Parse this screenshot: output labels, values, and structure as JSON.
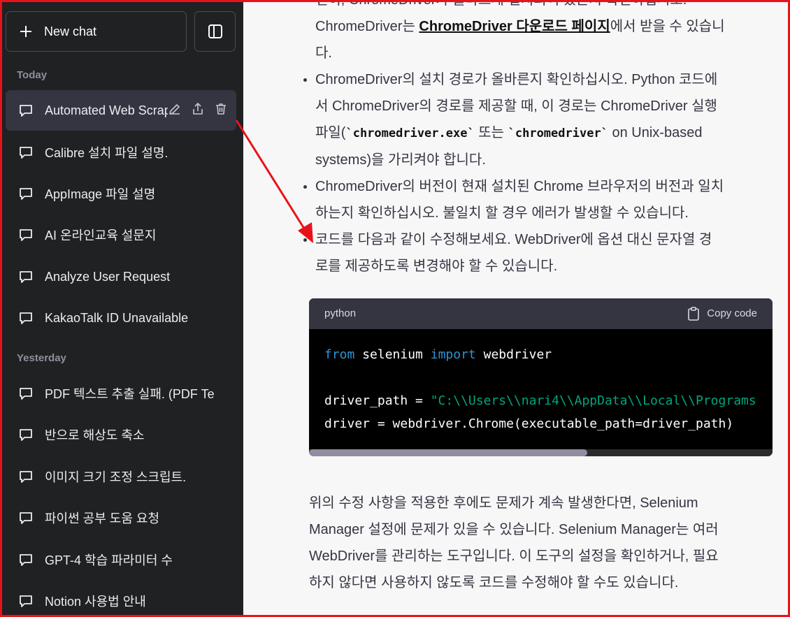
{
  "sidebar": {
    "new_chat_label": "New chat",
    "sections": [
      {
        "label": "Today"
      },
      {
        "label": "Yesterday"
      }
    ],
    "today_items": [
      "Automated Web Scraping",
      "Calibre 설치 파일 설명.",
      "AppImage 파일 설명",
      "AI 온라인교육 설문지",
      "Analyze User Request",
      "KakaoTalk ID Unavailable"
    ],
    "yesterday_items": [
      "PDF 텍스트 추출 실패. (PDF Te",
      "반으로 해상도 축소",
      "이미지 크기 조정 스크립트.",
      "파이썬 공부 도움 요청",
      "GPT-4 학습 파라미터 수",
      "Notion 사용법 안내"
    ],
    "icons": {
      "new_chat": "plus-icon",
      "toggle": "sidebar-toggle-icon",
      "chat": "chat-bubble-icon",
      "edit": "pencil-icon",
      "share": "share-icon",
      "delete": "trash-icon"
    }
  },
  "main": {
    "line0_clipped": "전히, ChromeDriver가 올바르게 설치되어 있는지 확인하십시오.",
    "b1_text_a": "ChromeDriver는 ",
    "b1_link": "ChromeDriver 다운로드 페이지",
    "b1_text_b": "에서 받을 수 있습니",
    "b1_text_c": "다.",
    "b2_a": "ChromeDriver의 설치 경로가 올바른지 확인하십시오. Python 코드에",
    "b2_b": "서 ChromeDriver의 경로를 제공할 때, 이 경로는 ChromeDriver 실행",
    "b2_c": "파일(",
    "b2_code1": "`chromedriver.exe`",
    "b2_d": " 또는 ",
    "b2_code2": "`chromedriver`",
    "b2_e": " on Unix-based",
    "b2_f": "systems)을 가리켜야 합니다.",
    "b3_a": "ChromeDriver의 버전이 현재 설치된 Chrome 브라우저의 버전과 일치",
    "b3_b": "하는지 확인하십시오. 불일치 할 경우 에러가 발생할 수 있습니다.",
    "b4_a": "코드를 다음과 같이 수정해보세요. WebDriver에 옵션 대신 문자열 경",
    "b4_b": "로를 제공하도록 변경해야 할 수 있습니다.",
    "code": {
      "language": "python",
      "copy_label": "Copy code",
      "l1_kw1": "from",
      "l1_mid": " selenium ",
      "l1_kw2": "import",
      "l1_end": " webdriver",
      "l2_a": "driver_path = ",
      "l2_str": "\"C:\\\\Users\\\\nari4\\\\AppData\\\\Local\\\\Programs",
      "l3": "driver = webdriver.Chrome(executable_path=driver_path)",
      "scroll_fraction": 0.6
    },
    "para_a": "위의 수정 사항을 적용한 후에도 문제가 계속 발생한다면, Selenium",
    "para_b": "Manager 설정에 문제가 있을 수 있습니다. Selenium Manager는 여러",
    "para_c": "WebDriver를 관리하는 도구입니다. 이 도구의 설정을 확인하거나, 필요",
    "para_d": "하지 않다면 사용하지 않도록 코드를 수정해야 할 수도 있습니다."
  },
  "annotation": {
    "arrow_color": "#e8131a",
    "frame_color": "#e8131a"
  }
}
